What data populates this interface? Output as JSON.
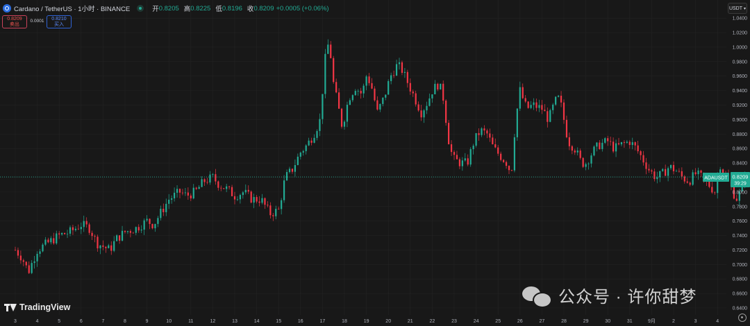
{
  "header": {
    "symbol_title": "Cardano / TetherUS · 1小时 · BINANCE",
    "ohlc": [
      {
        "key": "开",
        "value": "0.8205"
      },
      {
        "key": "高",
        "value": "0.8225"
      },
      {
        "key": "低",
        "value": "0.8196"
      },
      {
        "key": "收",
        "value": "0.8209"
      }
    ],
    "change": "+0.0005 (+0.06%)",
    "icons": {
      "symbol": "cardano-logo-icon",
      "status": "market-open-icon"
    }
  },
  "trade_panel": {
    "sell_price": "0.8209",
    "sell_label": "卖出",
    "spread": "0.0001",
    "buy_price": "0.8210",
    "buy_label": "买入"
  },
  "currency_button": "USDT",
  "price_tag": {
    "symbol": "ADAUSDT",
    "price": "0.8209",
    "countdown": "39:29"
  },
  "branding": {
    "logo_text": "TradingView"
  },
  "watermark": {
    "text": "公众号 · 许你甜梦"
  },
  "colors": {
    "background": "#181818",
    "up": "#22ab94",
    "down": "#f23645",
    "text": "#d1d4dc",
    "grid": "#232323",
    "price_line": "#22ab94"
  },
  "chart_data": {
    "type": "candlestick",
    "title": "Cardano / TetherUS · 1小时 · BINANCE",
    "ylim": [
      0.64,
      1.044
    ],
    "y_ticks": [
      "1.0400",
      "1.0200",
      "1.0000",
      "0.9800",
      "0.9600",
      "0.9400",
      "0.9200",
      "0.9000",
      "0.8800",
      "0.8600",
      "0.8400",
      "0.8200",
      "0.8000",
      "0.7800",
      "0.7600",
      "0.7400",
      "0.7200",
      "0.7000",
      "0.6800",
      "0.6600",
      "0.6400"
    ],
    "x_ticks": [
      "3",
      "4",
      "5",
      "6",
      "7",
      "8",
      "9",
      "10",
      "11",
      "12",
      "13",
      "14",
      "15",
      "16",
      "17",
      "18",
      "19",
      "20",
      "21",
      "22",
      "23",
      "24",
      "25",
      "26",
      "27",
      "28",
      "29",
      "30",
      "31",
      "9月",
      "2",
      "3",
      "4"
    ],
    "x_tick_index_of_first": 0,
    "last_price": 0.8209,
    "close_path": [
      [
        0.0,
        0.72
      ],
      [
        0.3,
        0.71
      ],
      [
        0.6,
        0.69
      ],
      [
        1.0,
        0.72
      ],
      [
        1.5,
        0.73
      ],
      [
        2.0,
        0.74
      ],
      [
        2.5,
        0.745
      ],
      [
        3.0,
        0.755
      ],
      [
        3.4,
        0.75
      ],
      [
        3.7,
        0.73
      ],
      [
        4.0,
        0.725
      ],
      [
        4.3,
        0.72
      ],
      [
        4.6,
        0.735
      ],
      [
        5.0,
        0.745
      ],
      [
        5.5,
        0.75
      ],
      [
        6.0,
        0.76
      ],
      [
        6.3,
        0.755
      ],
      [
        6.6,
        0.77
      ],
      [
        7.0,
        0.79
      ],
      [
        7.5,
        0.8
      ],
      [
        7.8,
        0.795
      ],
      [
        8.2,
        0.8
      ],
      [
        8.6,
        0.815
      ],
      [
        9.0,
        0.82
      ],
      [
        9.3,
        0.81
      ],
      [
        9.6,
        0.805
      ],
      [
        10.0,
        0.795
      ],
      [
        10.4,
        0.8
      ],
      [
        10.8,
        0.79
      ],
      [
        11.2,
        0.79
      ],
      [
        11.6,
        0.77
      ],
      [
        12.0,
        0.775
      ],
      [
        12.3,
        0.82
      ],
      [
        12.6,
        0.83
      ],
      [
        13.0,
        0.855
      ],
      [
        13.3,
        0.865
      ],
      [
        13.6,
        0.88
      ],
      [
        13.9,
        0.9
      ],
      [
        14.1,
        0.98
      ],
      [
        14.3,
        1.01
      ],
      [
        14.5,
        0.95
      ],
      [
        14.7,
        0.92
      ],
      [
        14.9,
        0.89
      ],
      [
        15.2,
        0.93
      ],
      [
        15.5,
        0.945
      ],
      [
        15.8,
        0.935
      ],
      [
        16.0,
        0.96
      ],
      [
        16.2,
        0.95
      ],
      [
        16.5,
        0.91
      ],
      [
        16.8,
        0.93
      ],
      [
        17.1,
        0.96
      ],
      [
        17.4,
        0.975
      ],
      [
        17.6,
        0.97
      ],
      [
        17.9,
        0.95
      ],
      [
        18.2,
        0.93
      ],
      [
        18.5,
        0.91
      ],
      [
        18.8,
        0.925
      ],
      [
        19.0,
        0.94
      ],
      [
        19.3,
        0.95
      ],
      [
        19.5,
        0.93
      ],
      [
        19.8,
        0.86
      ],
      [
        20.0,
        0.845
      ],
      [
        20.3,
        0.84
      ],
      [
        20.6,
        0.84
      ],
      [
        20.9,
        0.87
      ],
      [
        21.2,
        0.885
      ],
      [
        21.5,
        0.88
      ],
      [
        21.8,
        0.86
      ],
      [
        22.1,
        0.85
      ],
      [
        22.4,
        0.84
      ],
      [
        22.6,
        0.825
      ],
      [
        22.8,
        0.9
      ],
      [
        23.0,
        0.94
      ],
      [
        23.3,
        0.915
      ],
      [
        23.6,
        0.92
      ],
      [
        24.0,
        0.915
      ],
      [
        24.3,
        0.9
      ],
      [
        24.6,
        0.925
      ],
      [
        24.8,
        0.93
      ],
      [
        25.0,
        0.9
      ],
      [
        25.2,
        0.87
      ],
      [
        25.5,
        0.86
      ],
      [
        25.8,
        0.84
      ],
      [
        26.0,
        0.84
      ],
      [
        26.3,
        0.855
      ],
      [
        26.6,
        0.865
      ],
      [
        27.0,
        0.87
      ],
      [
        27.3,
        0.86
      ],
      [
        27.6,
        0.865
      ],
      [
        28.0,
        0.87
      ],
      [
        28.3,
        0.86
      ],
      [
        28.6,
        0.845
      ],
      [
        28.9,
        0.83
      ],
      [
        29.2,
        0.82
      ],
      [
        29.5,
        0.825
      ],
      [
        29.8,
        0.835
      ],
      [
        30.1,
        0.83
      ],
      [
        30.4,
        0.82
      ],
      [
        30.7,
        0.815
      ],
      [
        31.0,
        0.825
      ],
      [
        31.3,
        0.82
      ],
      [
        31.6,
        0.81
      ],
      [
        31.9,
        0.8
      ],
      [
        32.1,
        0.84
      ],
      [
        32.3,
        0.825
      ],
      [
        32.5,
        0.815
      ],
      [
        32.7,
        0.8
      ],
      [
        32.9,
        0.79
      ],
      [
        33.1,
        0.805
      ],
      [
        33.3,
        0.8209
      ]
    ]
  }
}
